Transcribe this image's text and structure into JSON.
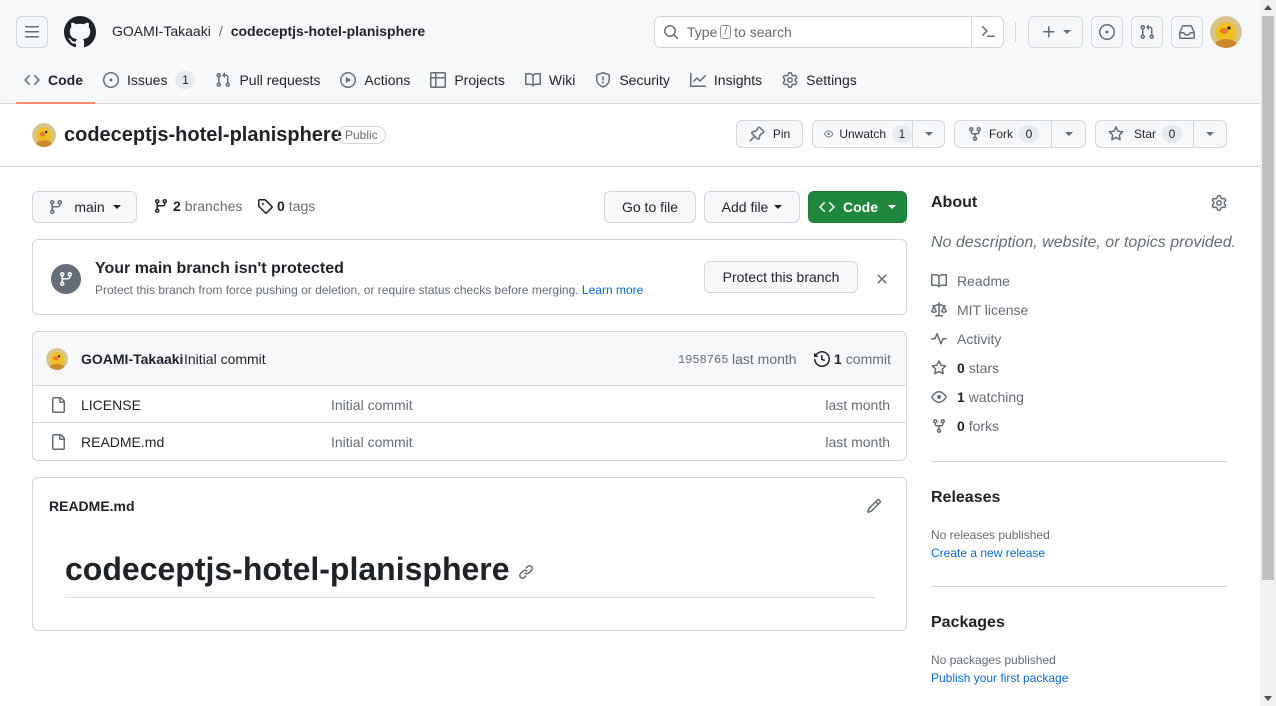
{
  "header": {
    "owner": "GOAMI-Takaaki",
    "separator": "/",
    "repo": "codeceptjs-hotel-planisphere",
    "search_placeholder_pre": "Type",
    "search_kbd": "/",
    "search_placeholder_post": "to search"
  },
  "tabs": [
    {
      "label": "Code",
      "icon": "code-icon",
      "active": true
    },
    {
      "label": "Issues",
      "icon": "issue-icon",
      "count": "1"
    },
    {
      "label": "Pull requests",
      "icon": "pull-request-icon"
    },
    {
      "label": "Actions",
      "icon": "play-icon"
    },
    {
      "label": "Projects",
      "icon": "table-icon"
    },
    {
      "label": "Wiki",
      "icon": "book-icon"
    },
    {
      "label": "Security",
      "icon": "shield-icon"
    },
    {
      "label": "Insights",
      "icon": "graph-icon"
    },
    {
      "label": "Settings",
      "icon": "gear-icon"
    }
  ],
  "repo_bar": {
    "name": "codeceptjs-hotel-planisphere",
    "visibility": "Public",
    "pin_label": "Pin",
    "unwatch_label": "Unwatch",
    "watch_count": "1",
    "fork_label": "Fork",
    "fork_count": "0",
    "star_label": "Star",
    "star_count": "0"
  },
  "toolbar": {
    "branch": "main",
    "branches_count": "2",
    "branches_label": "branches",
    "tags_count": "0",
    "tags_label": "tags",
    "go_to_file": "Go to file",
    "add_file": "Add file",
    "code": "Code"
  },
  "protect": {
    "title": "Your main branch isn't protected",
    "desc": "Protect this branch from force pushing or deletion, or require status checks before merging.",
    "learn_more": "Learn more",
    "button": "Protect this branch"
  },
  "commit": {
    "author": "GOAMI-Takaaki",
    "message": "Initial commit",
    "sha": "1958765",
    "time": "last month",
    "count": "1",
    "count_label": "commit"
  },
  "files": [
    {
      "name": "LICENSE",
      "message": "Initial commit",
      "time": "last month"
    },
    {
      "name": "README.md",
      "message": "Initial commit",
      "time": "last month"
    }
  ],
  "readme": {
    "filename": "README.md",
    "heading": "codeceptjs-hotel-planisphere"
  },
  "about": {
    "title": "About",
    "description": "No description, website, or topics provided.",
    "readme": "Readme",
    "license": "MIT license",
    "activity": "Activity",
    "stars_count": "0",
    "stars_label": "stars",
    "watching_count": "1",
    "watching_label": "watching",
    "forks_count": "0",
    "forks_label": "forks"
  },
  "releases": {
    "title": "Releases",
    "none": "No releases published",
    "create": "Create a new release"
  },
  "packages": {
    "title": "Packages",
    "none": "No packages published",
    "publish": "Publish your first package"
  },
  "colors": {
    "accent": "#0969da",
    "green": "#1f883d",
    "tab_underline": "#fd8c73"
  }
}
